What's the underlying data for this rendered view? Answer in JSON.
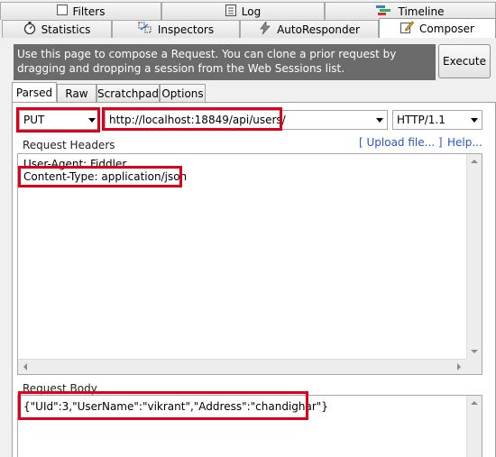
{
  "tabs_top": [
    {
      "label": "Filters",
      "icon": "checkbox-icon"
    },
    {
      "label": "Log",
      "icon": "log-icon"
    },
    {
      "label": "Timeline",
      "icon": "timeline-icon"
    }
  ],
  "tabs_bottom": [
    {
      "label": "Statistics",
      "icon": "stopwatch-icon"
    },
    {
      "label": "Inspectors",
      "icon": "inspectors-icon"
    },
    {
      "label": "AutoResponder",
      "icon": "autoresponder-icon"
    },
    {
      "label": "Composer",
      "icon": "composer-icon",
      "active": true
    }
  ],
  "banner": {
    "text": "Use this page to compose a Request. You can clone a prior request by dragging and dropping a session from the Web Sessions list."
  },
  "execute_label": "Execute",
  "composer_tabs": [
    {
      "label": "Parsed",
      "active": true
    },
    {
      "label": "Raw"
    },
    {
      "label": "Scratchpad"
    },
    {
      "label": "Options"
    }
  ],
  "request": {
    "method": "PUT",
    "url": "http://localhost:18849/api/users/",
    "http_version": "HTTP/1.1"
  },
  "headers": {
    "label": "Request Headers",
    "upload_link": "[ Upload file... ]",
    "help_link": "Help...",
    "lines": [
      "User-Agent: Fiddler",
      "Content-Type: application/json"
    ]
  },
  "body": {
    "label": "Request Body",
    "content": "{\"UId\":3,\"UserName\":\"vikrant\",\"Address\":\"chandighar\"}"
  },
  "colors": {
    "highlight": "#e0001a",
    "banner_bg": "#6b6b6b",
    "link": "#2a55c8"
  }
}
